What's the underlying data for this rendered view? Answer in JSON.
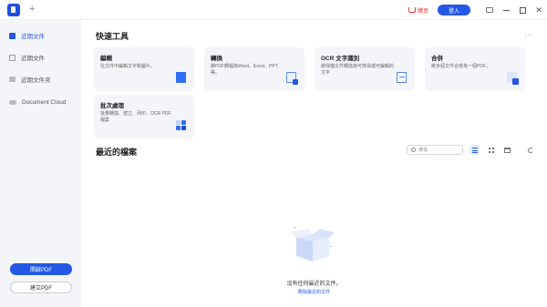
{
  "titlebar": {
    "new_tab": "+",
    "cart_label": "購買",
    "login_label": "登入"
  },
  "sidebar": {
    "items": [
      {
        "label": "近期文件",
        "icon": "recent-files-icon",
        "active": true
      },
      {
        "label": "近期文件",
        "icon": "document-icon",
        "active": false
      },
      {
        "label": "近期文件夾",
        "icon": "folder-icon",
        "active": false
      },
      {
        "label": "Document Cloud",
        "icon": "cloud-icon",
        "active": false
      }
    ],
    "open_pdf_label": "開啟PDF",
    "create_pdf_label": "建立PDF"
  },
  "main": {
    "quick_tools_title": "快速工具",
    "more_label": "···",
    "tools": [
      {
        "title": "編輯",
        "desc": "在文件中編輯文字和圖片。",
        "icon": "edit-icon"
      },
      {
        "title": "轉換",
        "desc": "將PDF轉檔為Word、Excel、PPT等。",
        "icon": "convert-icon"
      },
      {
        "title": "OCR 文字識別",
        "desc": "將掃描文件轉換為可搜尋或可編輯的文字",
        "icon": "ocr-icon"
      },
      {
        "title": "合併",
        "desc": "將多個文件合併為一個PDF。",
        "icon": "merge-icon"
      },
      {
        "title": "批次處理",
        "desc": "批量轉換、建立、列印、OCR PDF檔案",
        "icon": "batch-icon"
      }
    ],
    "recent_title": "最近的檔案",
    "search_placeholder": "搜尋",
    "empty_text": "沒有任何最近的文件。",
    "empty_link": "刪除最近的文件"
  },
  "colors": {
    "accent": "#2457e5",
    "sidebar_bg": "#f4f5f8",
    "card_bg": "#f4f5f8",
    "cart_red": "#e8483b"
  }
}
